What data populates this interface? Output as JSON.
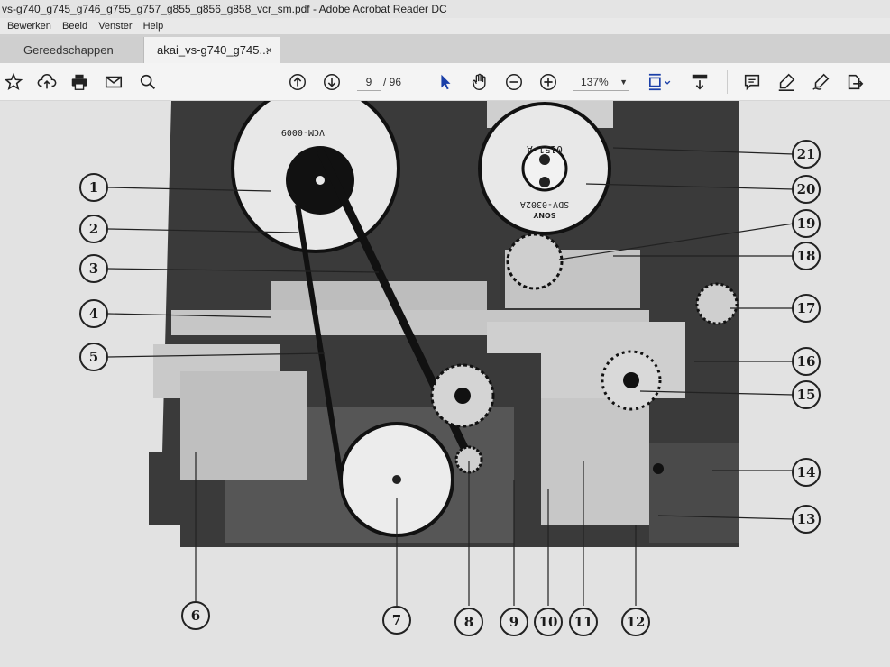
{
  "window": {
    "title": "vs-g740_g745_g746_g755_g757_g855_g856_g858_vcr_sm.pdf - Adobe Acrobat Reader DC"
  },
  "menu": [
    "Bewerken",
    "Beeld",
    "Venster",
    "Help"
  ],
  "tabs": {
    "tools": "Gereedschappen",
    "document": "akai_vs-g740_g745...",
    "close": "×"
  },
  "toolbar": {
    "page_current": "9",
    "page_total": "/ 96",
    "zoom": "137%",
    "icons": [
      "star-icon",
      "upload-icon",
      "print-icon",
      "mail-icon",
      "find-icon",
      "prev-page-icon",
      "next-page-icon",
      "select-arrow-icon",
      "hand-icon",
      "zoom-out-icon",
      "zoom-in-icon",
      "fit-page-icon",
      "scroll-mode-icon",
      "comment-icon",
      "highlight-pen-icon",
      "sign-icon",
      "share-icon"
    ]
  },
  "figure": {
    "reel_label_left": "VCM-0009",
    "reel_label_right_top": "0151-A",
    "reel_label_right_bottom": "SDV-0302A",
    "brand_text": "SONY",
    "callouts": [
      "1",
      "2",
      "3",
      "4",
      "5",
      "6",
      "7",
      "8",
      "9",
      "10",
      "11",
      "12",
      "13",
      "14",
      "15",
      "16",
      "17",
      "18",
      "19",
      "20",
      "21"
    ]
  }
}
